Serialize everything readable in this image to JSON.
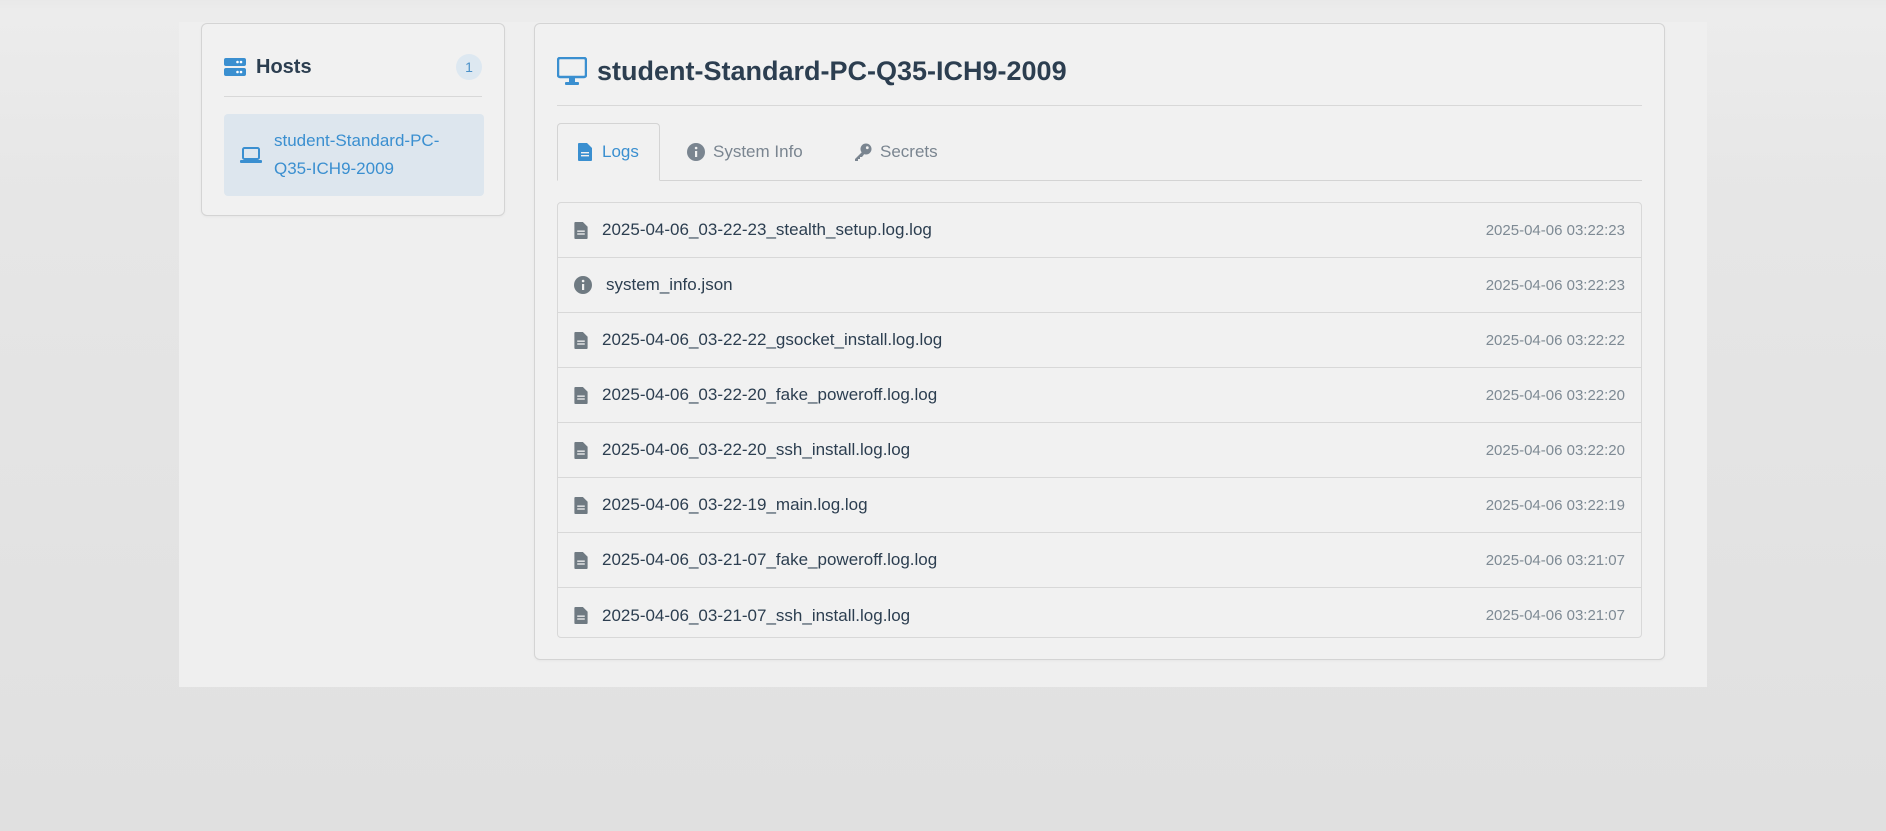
{
  "colors": {
    "accent": "#3a8fd0",
    "text": "#2c3e50",
    "muted": "#7e8a94",
    "icon_gray": "#6f7a82"
  },
  "sidebar": {
    "title": "Hosts",
    "title_icon": "server-icon",
    "count": "1",
    "items": [
      {
        "label": "student-Standard-PC-Q35-ICH9-2009",
        "icon": "laptop-icon",
        "selected": true
      }
    ]
  },
  "main": {
    "title": "student-Standard-PC-Q35-ICH9-2009",
    "title_icon": "desktop-icon",
    "tabs": [
      {
        "label": "Logs",
        "icon": "file-icon",
        "active": true
      },
      {
        "label": "System Info",
        "icon": "info-circle-icon",
        "active": false
      },
      {
        "label": "Secrets",
        "icon": "key-icon",
        "active": false
      }
    ],
    "logs": [
      {
        "name": "2025-04-06_03-22-23_stealth_setup.log.log",
        "time": "2025-04-06 03:22:23",
        "icon": "file-icon"
      },
      {
        "name": "system_info.json",
        "time": "2025-04-06 03:22:23",
        "icon": "info-circle-icon"
      },
      {
        "name": "2025-04-06_03-22-22_gsocket_install.log.log",
        "time": "2025-04-06 03:22:22",
        "icon": "file-icon"
      },
      {
        "name": "2025-04-06_03-22-20_fake_poweroff.log.log",
        "time": "2025-04-06 03:22:20",
        "icon": "file-icon"
      },
      {
        "name": "2025-04-06_03-22-20_ssh_install.log.log",
        "time": "2025-04-06 03:22:20",
        "icon": "file-icon"
      },
      {
        "name": "2025-04-06_03-22-19_main.log.log",
        "time": "2025-04-06 03:22:19",
        "icon": "file-icon"
      },
      {
        "name": "2025-04-06_03-21-07_fake_poweroff.log.log",
        "time": "2025-04-06 03:21:07",
        "icon": "file-icon"
      },
      {
        "name": "2025-04-06_03-21-07_ssh_install.log.log",
        "time": "2025-04-06 03:21:07",
        "icon": "file-icon"
      }
    ]
  }
}
